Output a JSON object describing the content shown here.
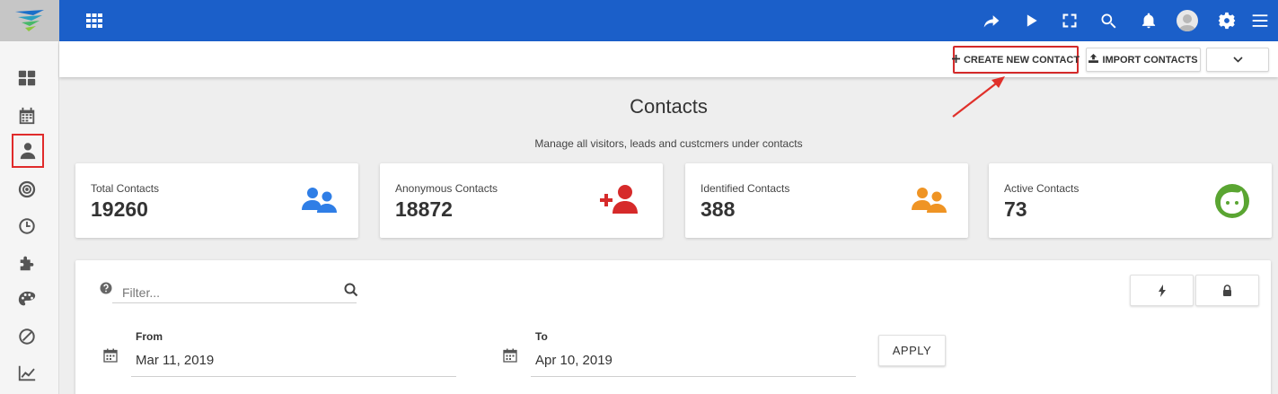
{
  "actions": {
    "create_label": "CREATE NEW CONTACT",
    "import_label": "IMPORT CONTACTS"
  },
  "page": {
    "title": "Contacts",
    "subtitle": "Manage all visitors, leads and custcmers under contacts"
  },
  "stats": [
    {
      "label": "Total Contacts",
      "value": "19260",
      "color": "#2f7ee6"
    },
    {
      "label": "Anonymous Contacts",
      "value": "18872",
      "color": "#d62a2a"
    },
    {
      "label": "Identified Contacts",
      "value": "388",
      "color": "#ef9424"
    },
    {
      "label": "Active Contacts",
      "value": "73",
      "color": "#5aa532"
    }
  ],
  "filter": {
    "placeholder": "Filter...",
    "from_label": "From",
    "from_value": "Mar 11, 2019",
    "to_label": "To",
    "to_value": "Apr 10, 2019",
    "apply_label": "APPLY"
  },
  "colors": {
    "topbar": "#1b5fc9",
    "highlight": "#d42a2a"
  },
  "icons": {
    "sidebar": [
      "dashboard-icon",
      "calendar-icon",
      "user-icon",
      "target-icon",
      "clock-icon",
      "puzzle-icon",
      "palette-icon",
      "block-icon",
      "chart-icon"
    ],
    "topbar": [
      "apps-icon",
      "share-icon",
      "play-icon",
      "fullscreen-icon",
      "search-icon",
      "bell-icon",
      "avatar-icon",
      "gear-icon",
      "menu-icon"
    ]
  }
}
